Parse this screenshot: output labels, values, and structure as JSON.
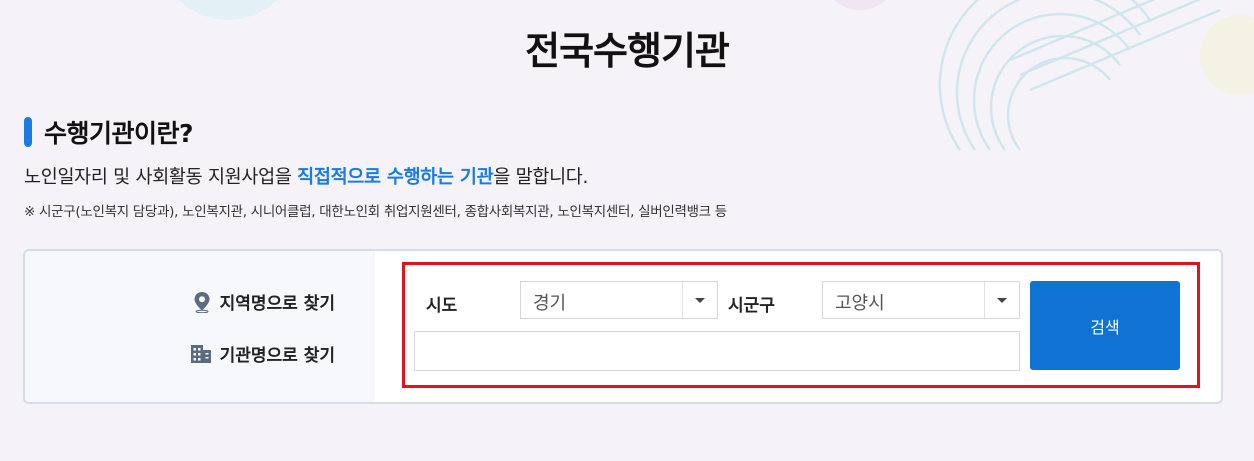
{
  "page": {
    "title": "전국수행기관"
  },
  "section": {
    "title": "수행기관이란?",
    "desc_pre": "노인일자리 및 사회활동 지원사업을 ",
    "desc_highlight": "직접적으로 수행하는 기관",
    "desc_post": "을 말합니다.",
    "note": "※ 시군구(노인복지 담당과), 노인복지관, 시니어클럽, 대한노인회 취업지원센터, 종합사회복지관, 노인복지센터, 실버인력뱅크 등"
  },
  "search": {
    "options": {
      "by_region": "지역명으로 찾기",
      "by_name": "기관명으로 찾기"
    },
    "sido_label": "시도",
    "sido_value": "경기",
    "sigungu_label": "시군구",
    "sigungu_value": "고양시",
    "keyword_value": "",
    "keyword_placeholder": "",
    "button_label": "검색"
  },
  "colors": {
    "accent": "#1a7be0",
    "button": "#0f72d4",
    "highlight_frame": "#e2141b"
  },
  "icons": {
    "region": "location-pin-icon",
    "name": "building-icon",
    "select_arrow": "chevron-down-icon"
  }
}
